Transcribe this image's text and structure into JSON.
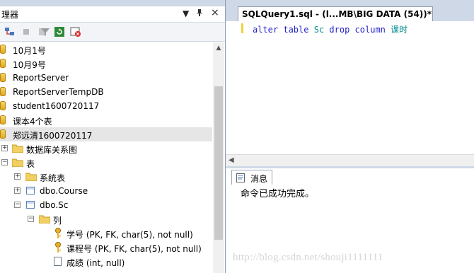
{
  "object_explorer": {
    "title": "理器",
    "title_buttons": {
      "dropdown": "▼",
      "pin": "ᵖ",
      "close": "×"
    },
    "tree": {
      "databases": [
        {
          "label": "10月1号"
        },
        {
          "label": "10月9号"
        },
        {
          "label": "ReportServer"
        },
        {
          "label": "ReportServerTempDB"
        },
        {
          "label": "student1600720117"
        },
        {
          "label": "课本4个表"
        },
        {
          "label": "郑远清1600720117",
          "selected": true
        }
      ],
      "diagrams_folder": "数据库关系图",
      "tables_folder": "表",
      "system_tables_folder": "系统表",
      "tables": [
        "dbo.Course",
        "dbo.Sc"
      ],
      "columns_folder": "列",
      "columns": [
        {
          "label": "学号 (PK, FK, char(5), not null)",
          "icon": "key-icon"
        },
        {
          "label": "课程号 (PK, FK, char(5), not null)",
          "icon": "key-icon"
        },
        {
          "label": "成绩 (int, null)",
          "icon": "column-icon"
        }
      ]
    }
  },
  "editor": {
    "tab_label": "SQLQuery1.sql - (l...MB\\BIG DATA (54))*",
    "code": {
      "kw1": "alter",
      "kw2": "table",
      "ident": "Sc",
      "kw3": "drop",
      "kw4": "column",
      "col": "课时"
    }
  },
  "results": {
    "tab_label": "消息",
    "message": "命令已成功完成。",
    "watermark": "http://blog.csdn.net/shouji1111111"
  },
  "colors": {
    "keyword": "#1f1fc8",
    "identifier": "#0a8f8f",
    "selection": "#e6e6e6",
    "chrome": "#cfd8e6"
  }
}
